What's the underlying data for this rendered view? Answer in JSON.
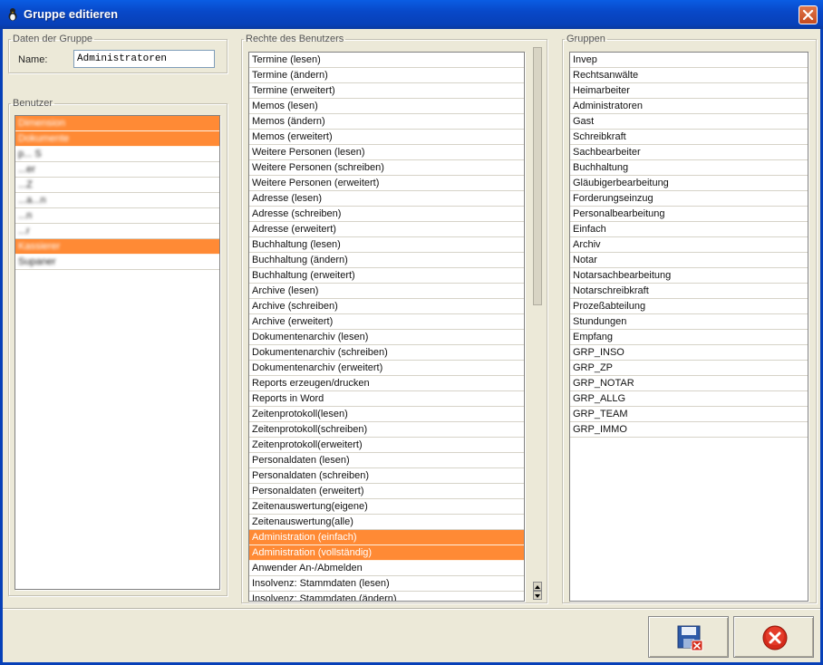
{
  "window": {
    "title": "Gruppe editieren",
    "close_icon": "close-icon",
    "app_icon": "app-icon"
  },
  "group_data": {
    "legend": "Daten der Gruppe",
    "name_label": "Name:",
    "name_value": "Administratoren"
  },
  "users": {
    "legend": "Benutzer",
    "items": [
      {
        "label": "Dimension",
        "selected": true
      },
      {
        "label": "Dokumente",
        "selected": true
      },
      {
        "label": "p... S",
        "selected": false
      },
      {
        "label": "...er",
        "selected": false
      },
      {
        "label": "...Z",
        "selected": false
      },
      {
        "label": "...a...n",
        "selected": false
      },
      {
        "label": "...n",
        "selected": false
      },
      {
        "label": "...r",
        "selected": false
      },
      {
        "label": "Kassierer",
        "selected": true
      },
      {
        "label": "Supaner",
        "selected": false
      }
    ]
  },
  "rights": {
    "legend": "Rechte des Benutzers",
    "items": [
      {
        "label": "Termine (lesen)",
        "selected": false
      },
      {
        "label": "Termine (ändern)",
        "selected": false
      },
      {
        "label": "Termine (erweitert)",
        "selected": false
      },
      {
        "label": "Memos (lesen)",
        "selected": false
      },
      {
        "label": "Memos (ändern)",
        "selected": false
      },
      {
        "label": "Memos (erweitert)",
        "selected": false
      },
      {
        "label": "Weitere Personen (lesen)",
        "selected": false
      },
      {
        "label": "Weitere Personen (schreiben)",
        "selected": false
      },
      {
        "label": "Weitere Personen (erweitert)",
        "selected": false
      },
      {
        "label": "Adresse (lesen)",
        "selected": false
      },
      {
        "label": "Adresse (schreiben)",
        "selected": false
      },
      {
        "label": "Adresse (erweitert)",
        "selected": false
      },
      {
        "label": "Buchhaltung (lesen)",
        "selected": false
      },
      {
        "label": "Buchhaltung (ändern)",
        "selected": false
      },
      {
        "label": "Buchhaltung (erweitert)",
        "selected": false
      },
      {
        "label": "Archive (lesen)",
        "selected": false
      },
      {
        "label": "Archive (schreiben)",
        "selected": false
      },
      {
        "label": "Archive (erweitert)",
        "selected": false
      },
      {
        "label": "Dokumentenarchiv (lesen)",
        "selected": false
      },
      {
        "label": "Dokumentenarchiv (schreiben)",
        "selected": false
      },
      {
        "label": "Dokumentenarchiv (erweitert)",
        "selected": false
      },
      {
        "label": "Reports erzeugen/drucken",
        "selected": false
      },
      {
        "label": "Reports in Word",
        "selected": false
      },
      {
        "label": "Zeitenprotokoll(lesen)",
        "selected": false
      },
      {
        "label": "Zeitenprotokoll(schreiben)",
        "selected": false
      },
      {
        "label": "Zeitenprotokoll(erweitert)",
        "selected": false
      },
      {
        "label": "Personaldaten (lesen)",
        "selected": false
      },
      {
        "label": "Personaldaten (schreiben)",
        "selected": false
      },
      {
        "label": "Personaldaten (erweitert)",
        "selected": false
      },
      {
        "label": "Zeitenauswertung(eigene)",
        "selected": false
      },
      {
        "label": "Zeitenauswertung(alle)",
        "selected": false
      },
      {
        "label": "Administration (einfach)",
        "selected": true
      },
      {
        "label": "Administration (vollständig)",
        "selected": true
      },
      {
        "label": "Anwender An-/Abmelden",
        "selected": false
      },
      {
        "label": "Insolvenz: Stammdaten (lesen)",
        "selected": false
      },
      {
        "label": "Insolvenz: Stammdaten (ändern)",
        "selected": false
      }
    ]
  },
  "groups": {
    "legend": "Gruppen",
    "items": [
      {
        "label": "Invep"
      },
      {
        "label": "Rechtsanwälte"
      },
      {
        "label": "Heimarbeiter"
      },
      {
        "label": "Administratoren"
      },
      {
        "label": "Gast"
      },
      {
        "label": "Schreibkraft"
      },
      {
        "label": "Sachbearbeiter"
      },
      {
        "label": "Buchhaltung"
      },
      {
        "label": "Gläubigerbearbeitung"
      },
      {
        "label": "Forderungseinzug"
      },
      {
        "label": "Personalbearbeitung"
      },
      {
        "label": "Einfach"
      },
      {
        "label": "Archiv"
      },
      {
        "label": "Notar"
      },
      {
        "label": "Notarsachbearbeitung"
      },
      {
        "label": "Notarschreibkraft"
      },
      {
        "label": "Prozeßabteilung"
      },
      {
        "label": "Stundungen"
      },
      {
        "label": "Empfang"
      },
      {
        "label": "GRP_INSO"
      },
      {
        "label": "GRP_ZP"
      },
      {
        "label": "GRP_NOTAR"
      },
      {
        "label": "GRP_ALLG"
      },
      {
        "label": "GRP_TEAM"
      },
      {
        "label": "GRP_IMMO"
      }
    ]
  },
  "buttons": {
    "save_icon": "save-floppy-icon",
    "cancel_icon": "cancel-icon"
  },
  "colors": {
    "selection": "#ff8a35",
    "titlebar": "#0848c8",
    "window_bg": "#ece9d8"
  }
}
